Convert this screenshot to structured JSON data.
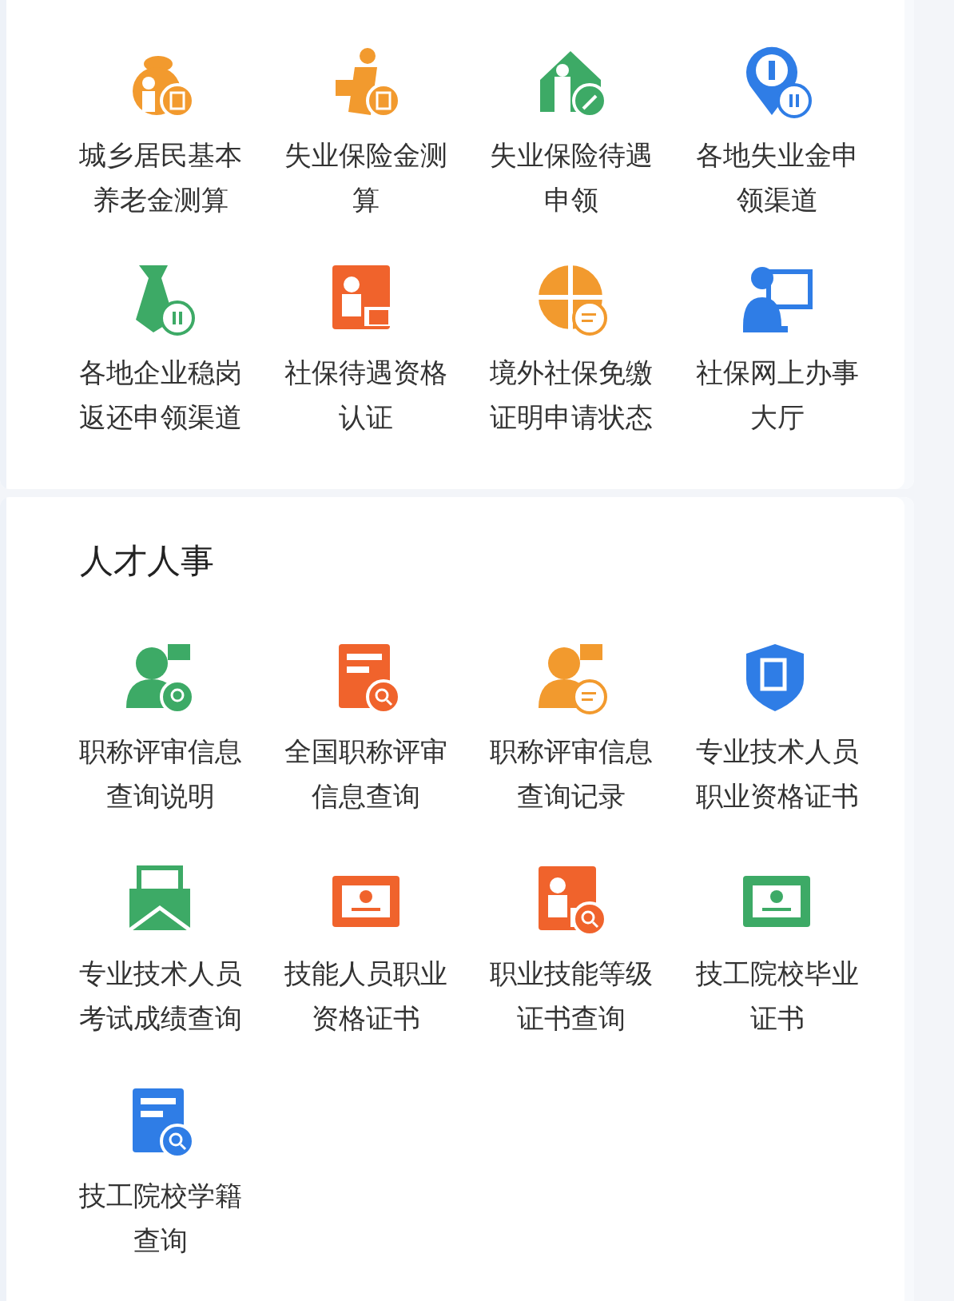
{
  "sections": [
    {
      "items": [
        {
          "label": "城乡居民基本养老金测算"
        },
        {
          "label": "失业保险金测算"
        },
        {
          "label": "失业保险待遇申领"
        },
        {
          "label": "各地失业金申领渠道"
        },
        {
          "label": "各地企业稳岗返还申领渠道"
        },
        {
          "label": "社保待遇资格认证"
        },
        {
          "label": "境外社保免缴证明申请状态"
        },
        {
          "label": "社保网上办事大厅"
        }
      ]
    },
    {
      "title": "人才人事",
      "items": [
        {
          "label": "职称评审信息查询说明"
        },
        {
          "label": "全国职称评审信息查询"
        },
        {
          "label": "职称评审信息查询记录"
        },
        {
          "label": "专业技术人员职业资格证书"
        },
        {
          "label": "专业技术人员考试成绩查询"
        },
        {
          "label": "技能人员职业资格证书"
        },
        {
          "label": "职业技能等级证书查询"
        },
        {
          "label": "技工院校毕业证书"
        },
        {
          "label": "技工院校学籍查询"
        }
      ]
    }
  ]
}
